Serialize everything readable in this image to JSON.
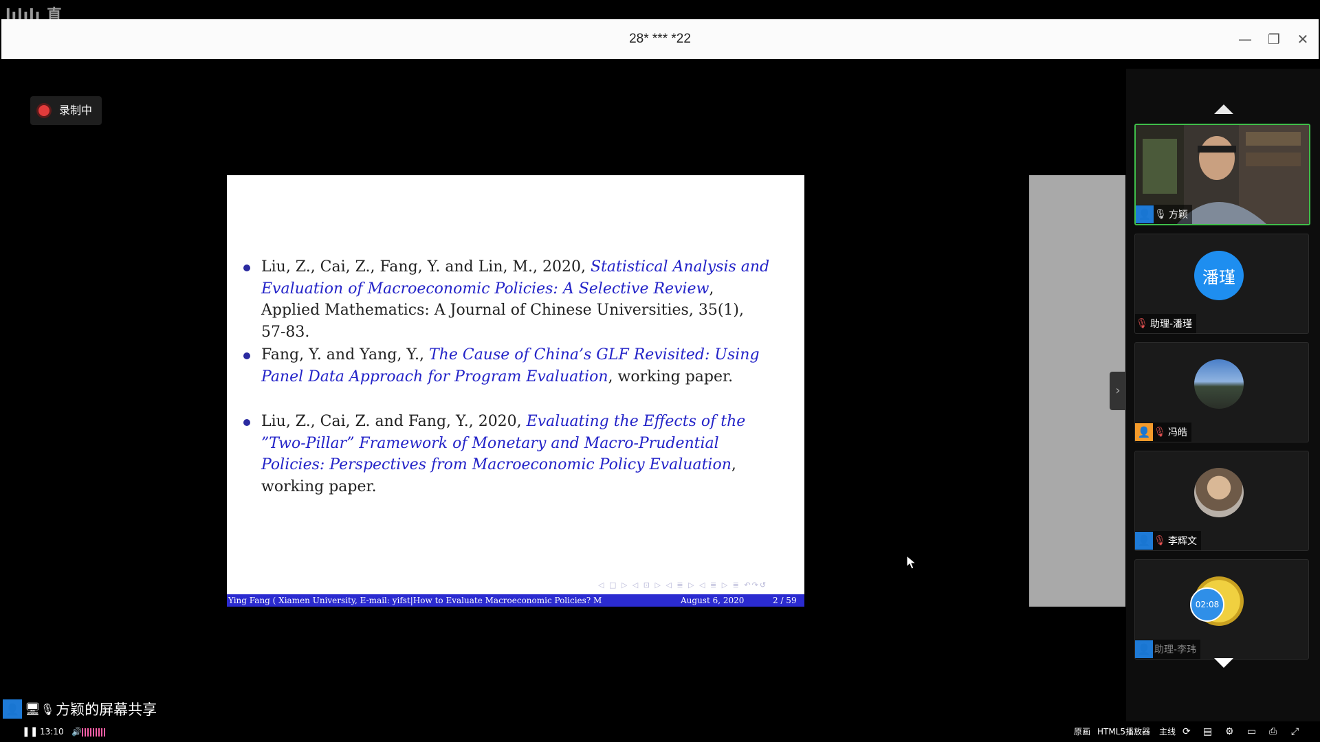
{
  "watermark": "lılılı 直",
  "window": {
    "title": "28* *** *22",
    "minimize_icon": "—",
    "restore_icon": "❐",
    "close_icon": "✕"
  },
  "recording": {
    "label": "录制中",
    "color": "#e23b3b"
  },
  "slide": {
    "references": [
      {
        "plain_before": "Liu, Z., Cai, Z., Fang, Y. and Lin, M., 2020, ",
        "title": "Statistical Analysis and Evaluation of Macroeconomic Policies: A Selective Review",
        "plain_after": ", Applied Mathematics: A Journal of Chinese Universities, 35(1), 57-83."
      },
      {
        "plain_before": "Fang, Y. and Yang, Y., ",
        "title": "The Cause of China’s GLF Revisited: Using Panel Data Approach for Program Evaluation",
        "plain_after": ", working paper."
      },
      {
        "plain_before": "Liu, Z., Cai, Z. and Fang, Y., 2020, ",
        "title": "Evaluating the Effects of the ”Two-Pillar” Framework of Monetary and Macro-Prudential Policies: Perspectives from Macroeconomic Policy Evaluation",
        "plain_after": ", working paper."
      }
    ],
    "nav_symbols": "◁ □ ▷ ◁ ⊡ ▷ ◁ ≣ ▷ ◁ ≣ ▷ ≣ ↶↷↺",
    "footer": {
      "author": "Ying Fang ( Xiamen University, E-mail: yifst|How to Evaluate Macroeconomic Policies? M",
      "date": "August 6, 2020",
      "page": "2 / 59"
    },
    "accent_color": "#2323c8"
  },
  "participants": [
    {
      "name": "方颖",
      "role": "blue",
      "avatar_type": "video"
    },
    {
      "name": "助理-潘瑾",
      "role": "none",
      "avatar_text": "潘瑾",
      "avatar_color": "#1e8ef0"
    },
    {
      "name": "冯皓",
      "role": "orange",
      "avatar_type": "landscape"
    },
    {
      "name": "李辉文",
      "role": "blue",
      "avatar_type": "photo"
    },
    {
      "name": "助理-李玮",
      "role": "blue",
      "avatar_type": "cartoon",
      "badge": "02:08"
    }
  ],
  "share": {
    "label": "方颖的屏幕共享"
  },
  "player": {
    "time": "13:10",
    "right_items": [
      "原画",
      "HTML5播放器",
      "主线"
    ],
    "icons": [
      "refresh-icon",
      "danmaku-icon",
      "settings-icon",
      "subtitle-icon",
      "screenshot-icon",
      "fullscreen-icon"
    ]
  }
}
